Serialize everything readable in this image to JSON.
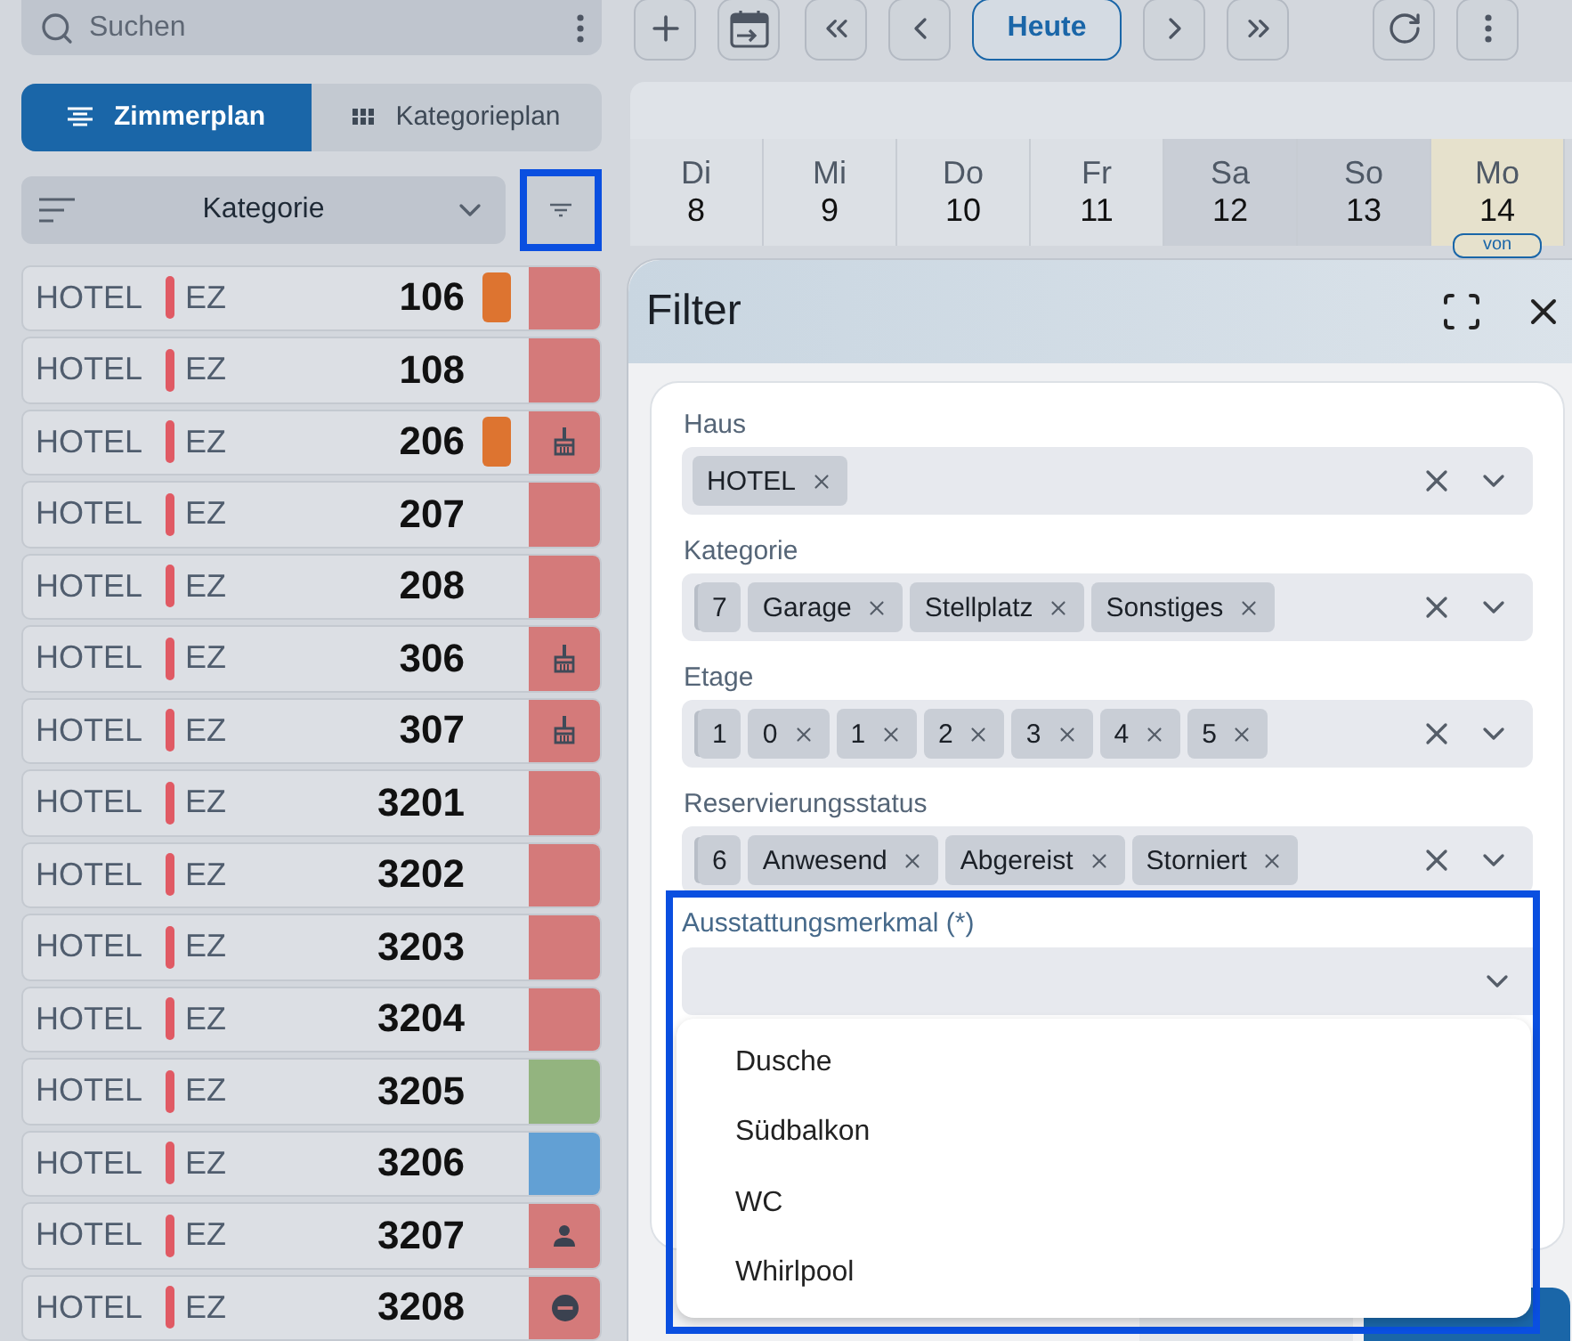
{
  "search": {
    "placeholder": "Suchen"
  },
  "view_tabs": [
    {
      "label": "Zimmerplan",
      "selected": true
    },
    {
      "label": "Kategorieplan",
      "selected": false
    }
  ],
  "sort": {
    "value": "Kategorie"
  },
  "rooms": [
    {
      "kind": "plain",
      "house": "HOTEL",
      "category": "EZ",
      "number": "106",
      "marked": true,
      "color": "#d47a7a"
    },
    {
      "kind": "plain",
      "house": "HOTEL",
      "category": "EZ",
      "number": "108",
      "marked": false,
      "color": "#d47a7a"
    },
    {
      "kind": "cleaning",
      "house": "HOTEL",
      "category": "EZ",
      "number": "206",
      "marked": true,
      "color": "#d47a7a"
    },
    {
      "kind": "plain",
      "house": "HOTEL",
      "category": "EZ",
      "number": "207",
      "marked": false,
      "color": "#d47a7a"
    },
    {
      "kind": "plain",
      "house": "HOTEL",
      "category": "EZ",
      "number": "208",
      "marked": false,
      "color": "#d47a7a"
    },
    {
      "kind": "cleaning",
      "house": "HOTEL",
      "category": "EZ",
      "number": "306",
      "marked": false,
      "color": "#d47a7a"
    },
    {
      "kind": "cleaning",
      "house": "HOTEL",
      "category": "EZ",
      "number": "307",
      "marked": false,
      "color": "#d47a7a"
    },
    {
      "kind": "plain",
      "house": "HOTEL",
      "category": "EZ",
      "number": "3201",
      "marked": false,
      "color": "#d47a7a"
    },
    {
      "kind": "plain",
      "house": "HOTEL",
      "category": "EZ",
      "number": "3202",
      "marked": false,
      "color": "#d47a7a"
    },
    {
      "kind": "plain",
      "house": "HOTEL",
      "category": "EZ",
      "number": "3203",
      "marked": false,
      "color": "#d47a7a"
    },
    {
      "kind": "plain",
      "house": "HOTEL",
      "category": "EZ",
      "number": "3204",
      "marked": false,
      "color": "#d47a7a"
    },
    {
      "kind": "plain",
      "house": "HOTEL",
      "category": "EZ",
      "number": "3205",
      "marked": false,
      "color": "#93b47f"
    },
    {
      "kind": "plain",
      "house": "HOTEL",
      "category": "EZ",
      "number": "3206",
      "marked": false,
      "color": "#62a0d4"
    },
    {
      "kind": "guest",
      "house": "HOTEL",
      "category": "EZ",
      "number": "3207",
      "marked": false,
      "color": "#d47a7a"
    },
    {
      "kind": "blocked",
      "house": "HOTEL",
      "category": "EZ",
      "number": "3208",
      "marked": false,
      "color": "#d47a7a"
    }
  ],
  "toolbar": {
    "today_button": "Heute"
  },
  "days": [
    {
      "weekday": "Di",
      "date": "8",
      "weekend": false,
      "today": false
    },
    {
      "weekday": "Mi",
      "date": "9",
      "weekend": false,
      "today": false
    },
    {
      "weekday": "Do",
      "date": "10",
      "weekend": false,
      "today": false
    },
    {
      "weekday": "Fr",
      "date": "11",
      "weekend": false,
      "today": false
    },
    {
      "weekday": "Sa",
      "date": "12",
      "weekend": true,
      "today": false
    },
    {
      "weekday": "So",
      "date": "13",
      "weekend": true,
      "today": false
    },
    {
      "weekday": "Mo",
      "date": "14",
      "weekend": false,
      "today": true,
      "badge": "von"
    }
  ],
  "dialog": {
    "title": "Filter",
    "fields": [
      {
        "label": "Haus",
        "chips": [
          {
            "kind": "tag",
            "text": "HOTEL"
          }
        ]
      },
      {
        "label": "Kategorie",
        "chips": [
          {
            "kind": "count",
            "text": "7"
          },
          {
            "kind": "tag",
            "text": "Garage"
          },
          {
            "kind": "tag",
            "text": "Stellplatz"
          },
          {
            "kind": "tag",
            "text": "Sonstiges"
          }
        ]
      },
      {
        "label": "Etage",
        "chips": [
          {
            "kind": "count",
            "text": "1"
          },
          {
            "kind": "tag",
            "text": "0"
          },
          {
            "kind": "tag",
            "text": "1"
          },
          {
            "kind": "tag",
            "text": "2"
          },
          {
            "kind": "tag",
            "text": "3"
          },
          {
            "kind": "tag",
            "text": "4"
          },
          {
            "kind": "tag",
            "text": "5"
          }
        ]
      },
      {
        "label": "Reservierungsstatus",
        "chips": [
          {
            "kind": "count",
            "text": "6"
          },
          {
            "kind": "tag",
            "text": "Anwesend"
          },
          {
            "kind": "tag",
            "text": "Abgereist"
          },
          {
            "kind": "tag",
            "text": "Storniert"
          }
        ]
      }
    ],
    "feature_field": {
      "label": "Ausstattungsmerkmal (*)",
      "expanded": true,
      "options": [
        "Dusche",
        "Südbalkon",
        "WC",
        "Whirlpool"
      ]
    }
  }
}
